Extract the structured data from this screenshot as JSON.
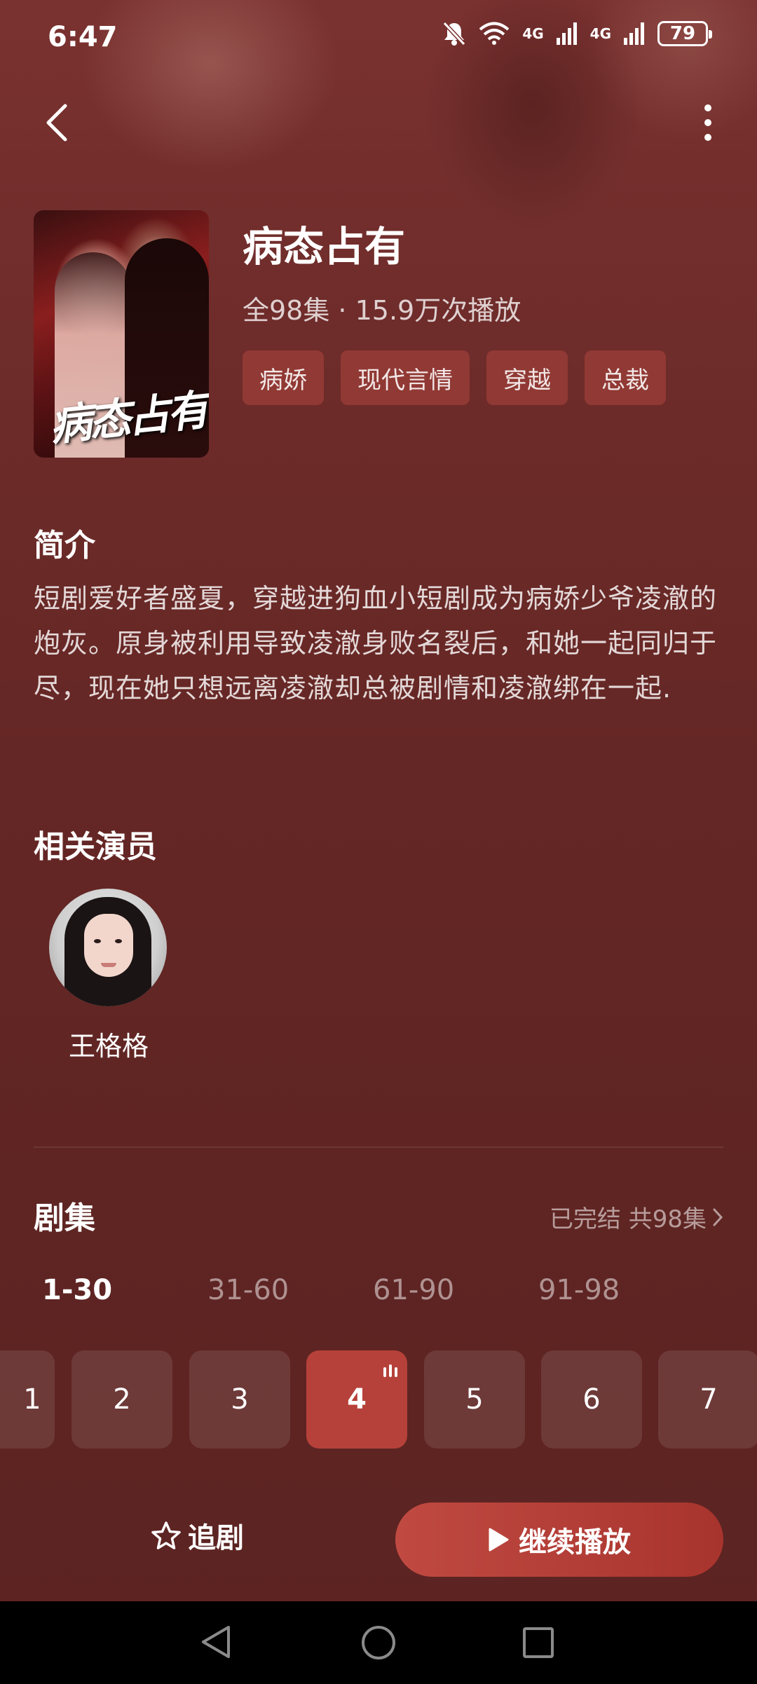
{
  "status_bar": {
    "time": "6:47",
    "network_1": "4G",
    "network_2": "4G",
    "battery": "79"
  },
  "show": {
    "title": "病态占有",
    "poster_title": "病态占有",
    "meta": "全98集 · 15.9万次播放",
    "tags": [
      "病娇",
      "现代言情",
      "穿越",
      "总裁"
    ]
  },
  "synopsis": {
    "heading": "简介",
    "text": "短剧爱好者盛夏，穿越进狗血小短剧成为病娇少爷凌澈的炮灰。原身被利用导致凌澈身败名裂后，和她一起同归于尽，现在她只想远离凌澈却总被剧情和凌澈绑在一起."
  },
  "cast": {
    "heading": "相关演员",
    "actors": [
      {
        "name": "王格格"
      }
    ]
  },
  "episodes": {
    "heading": "剧集",
    "status": "已完结 共98集",
    "ranges": [
      "1-30",
      "31-60",
      "61-90",
      "91-98"
    ],
    "active_range": "1-30",
    "visible": [
      "1",
      "2",
      "3",
      "4",
      "5",
      "6",
      "7"
    ],
    "current": "4"
  },
  "actions": {
    "follow_label": "追剧",
    "play_label": "继续播放"
  },
  "colors": {
    "accent": "#b6413a",
    "background": "#652725"
  }
}
